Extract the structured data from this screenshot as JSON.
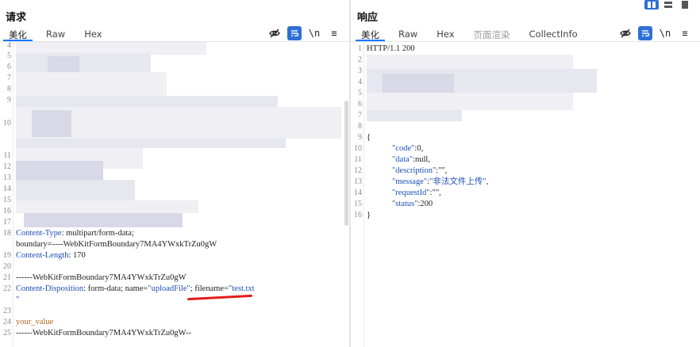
{
  "request": {
    "title": "请求",
    "tabs": [
      {
        "label": "美化",
        "active": true
      },
      {
        "label": "Raw",
        "active": false
      },
      {
        "label": "Hex",
        "active": false
      }
    ],
    "tools": {
      "hide_icon": "eye-off-icon",
      "wrap_icon": "wrap-icon",
      "newline_label": "\\n",
      "menu_label": "≡"
    },
    "lines": {
      "l4": "4",
      "l5": "5",
      "l6": "6",
      "l7": "7",
      "l8": "8",
      "l9": "9",
      "l10": "10",
      "l11": "11",
      "l12": "12",
      "l13": "13",
      "l14": "14",
      "l15": "15",
      "l16": "16",
      "l17": "17",
      "l18": "18",
      "l19": "19",
      "l20": "20",
      "l21": "21",
      "l22": "22",
      "l23": "23",
      "l24": "24",
      "l25": "25"
    },
    "code": {
      "ct_key": "Content-Type",
      "ct_value": ": multipart/form-data;",
      "ct_boundary": "boundary=----WebKitFormBoundary7MA4YWxkTrZu0gW",
      "cl_key": "Content-Length",
      "cl_value": ": 170",
      "boundary1": "------WebKitFormBoundary7MA4YWxkTrZu0gW",
      "cd_key": "Content-Disposition",
      "cd_value_prefix": ": form-data; name=",
      "cd_name": "\"uploadFile\"",
      "cd_mid": "; filename=",
      "cd_filename": "\"test.txt",
      "cd_cont": "\"",
      "body_value": "your_value",
      "boundary2": "------WebKitFormBoundary7MA4YWxkTrZu0gW--"
    }
  },
  "response": {
    "title": "响应",
    "tabs": [
      {
        "label": "美化",
        "active": true
      },
      {
        "label": "Raw",
        "active": false
      },
      {
        "label": "Hex",
        "active": false
      },
      {
        "label": "页面渲染",
        "active": false,
        "disabled": true
      },
      {
        "label": "CollectInfo",
        "active": false
      }
    ],
    "tools": {
      "hide_icon": "eye-off-icon",
      "wrap_icon": "wrap-icon",
      "newline_label": "\\n",
      "menu_label": "≡"
    },
    "lines": {
      "l1": "1",
      "l2": "2",
      "l3": "3",
      "l4": "4",
      "l5": "5",
      "l6": "6",
      "l7": "7",
      "l8": "8",
      "l9": "9",
      "l10": "10",
      "l11": "11",
      "l12": "12",
      "l13": "13",
      "l14": "14",
      "l15": "15",
      "l16": "16"
    },
    "code": {
      "status_line": "HTTP/1.1 200",
      "open": "{",
      "code_key": "\"code\"",
      "code_val": ":0,",
      "data_key": "\"data\"",
      "data_val": ":null,",
      "desc_key": "\"description\"",
      "desc_val": ":\"\",",
      "msg_key": "\"message\"",
      "msg_colon": ":",
      "msg_val": "\"非法文件上传\"",
      "msg_comma": ",",
      "req_key": "\"requestId\"",
      "req_val": ":\"\",",
      "status_key": "\"status\"",
      "status_val": ":200",
      "close": "}"
    }
  },
  "layout_buttons": {
    "icons": [
      "split-horizontal-icon",
      "split-vertical-icon",
      "single-pane-icon"
    ],
    "active_index": 0
  },
  "colors": {
    "accent": "#1677ff",
    "header_key": "#1a4fb5",
    "body_text": "#b5651d",
    "annotation": "#e21c1c"
  }
}
